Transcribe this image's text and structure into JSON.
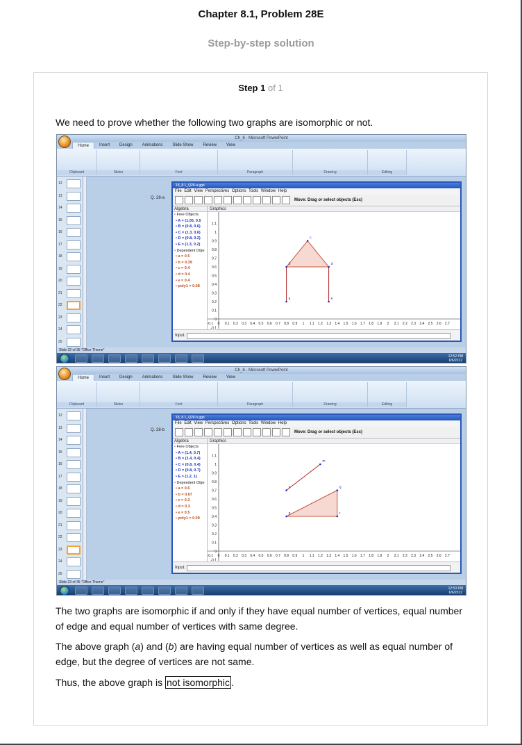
{
  "header": {
    "title": "Chapter 8.1, Problem 28E",
    "subtitle": "Step-by-step solution"
  },
  "step": {
    "label": "Step 1",
    "of_text": "of 1"
  },
  "paragraphs": {
    "intro": "We need to prove whether the following two graphs are isomorphic or not.",
    "p1": "The two graphs are isomorphic if and only if they have equal number of vertices, equal number of edge and equal number of vertices with same degree.",
    "p2_before_a": "The above graph (",
    "p2_a": "a",
    "p2_mid": ") and (",
    "p2_b": "b",
    "p2_after": ") are having equal number of vertices as well as equal number of edge, but the degree of vertices are not same.",
    "p3_before": "Thus, the above graph is ",
    "p3_boxed": "not isomorphic",
    "p3_after": "."
  },
  "screenshots": [
    {
      "window_title": "Ch_8 - Microsoft PowerPoint",
      "ribbon_tabs": [
        "Home",
        "Insert",
        "Design",
        "Animations",
        "Slide Show",
        "Review",
        "View"
      ],
      "slide_label": "Q. 28-a",
      "geogebra_title": "18_8.1_Q28-a.ggb",
      "geogebra_menu": "File Edit View Perspectives Options Tools Window Help",
      "toolbar_hint": "Move: Drag or select objects (Esc)",
      "algebra_header": "Algebra",
      "graphics_header": "Graphics",
      "free_header": "Free Objects",
      "free": [
        "A = (1.05, 0.5",
        "B = (0.8, 0.6)",
        "C = (1.3, 0.6)",
        "D = (0.8, 0.2)",
        "E = (1.3, 0.2)"
      ],
      "dep_header": "Dependent Obje",
      "dependent": [
        "a = 0.5",
        "b = 0.39",
        "c = 0.4",
        "d = 0.4",
        "e = 0.4",
        "poly1 = 0.08"
      ],
      "input_label": "Input:",
      "status": "Slide 22 of 35   \"Office Theme\"",
      "clock_time": "12:52 PM",
      "clock_date": "6/6/2012",
      "thumb_numbers": [
        "12",
        "13",
        "14",
        "15",
        "16",
        "17",
        "18",
        "19",
        "20",
        "21",
        "22",
        "23",
        "24",
        "25"
      ],
      "selected_thumb": 10,
      "points": [
        {
          "label": "c",
          "x": 1.05,
          "y": 0.9
        },
        {
          "label": "b",
          "x": 0.8,
          "y": 0.6
        },
        {
          "label": "d",
          "x": 1.3,
          "y": 0.6
        },
        {
          "label": "a",
          "x": 0.8,
          "y": 0.2
        },
        {
          "label": "e",
          "x": 1.3,
          "y": 0.2
        }
      ],
      "polygon": [
        [
          0.8,
          0.6
        ],
        [
          1.05,
          0.9
        ],
        [
          1.3,
          0.6
        ]
      ],
      "segments": [
        [
          [
            0.8,
            0.6
          ],
          [
            0.8,
            0.2
          ]
        ],
        [
          [
            1.3,
            0.6
          ],
          [
            1.3,
            0.2
          ]
        ]
      ]
    },
    {
      "window_title": "Ch_8 - Microsoft PowerPoint",
      "ribbon_tabs": [
        "Home",
        "Insert",
        "Design",
        "Animations",
        "Slide Show",
        "Review",
        "View"
      ],
      "slide_label": "Q. 28-b",
      "geogebra_title": "18_8.1_Q28-b.ggb",
      "geogebra_menu": "File Edit View Perspectives Options Tools Window Help",
      "toolbar_hint": "Move: Drag or select objects (Esc)",
      "algebra_header": "Algebra",
      "graphics_header": "Graphics",
      "free_header": "Free Objects",
      "free": [
        "A = (1.4, 0.7)",
        "B = (1.4, 0.4)",
        "C = (0.8, 0.4)",
        "D = (0.8, 0.7)",
        "E = (1.2, 1)"
      ],
      "dep_header": "Dependent Obje",
      "dependent": [
        "a = 0.6",
        "b = 0.67",
        "c = 0.3",
        "d = 0.3",
        "e = 0.5",
        "poly1 = 0.09"
      ],
      "input_label": "Input:",
      "status": "Slide 23 of 35   \"Office Theme\"",
      "clock_time": "12:53 PM",
      "clock_date": "6/6/2012",
      "thumb_numbers": [
        "12",
        "13",
        "14",
        "15",
        "16",
        "17",
        "18",
        "19",
        "20",
        "21",
        "22",
        "23",
        "24",
        "25"
      ],
      "selected_thumb": 11,
      "points": [
        {
          "label": "m",
          "x": 1.2,
          "y": 1.0
        },
        {
          "label": "n",
          "x": 0.8,
          "y": 0.7
        },
        {
          "label": "q",
          "x": 1.4,
          "y": 0.7
        },
        {
          "label": "p",
          "x": 0.8,
          "y": 0.4
        },
        {
          "label": "r",
          "x": 1.4,
          "y": 0.4
        }
      ],
      "polygon": [
        [
          0.8,
          0.4
        ],
        [
          1.4,
          0.7
        ],
        [
          1.4,
          0.4
        ]
      ],
      "segments": [
        [
          [
            0.8,
            0.7
          ],
          [
            1.2,
            1.0
          ]
        ]
      ]
    }
  ],
  "axis": {
    "x_ticks": [
      "-0.1",
      "0",
      "0.1",
      "0.2",
      "0.3",
      "0.4",
      "0.5",
      "0.6",
      "0.7",
      "0.8",
      "0.9",
      "1",
      "1.1",
      "1.2",
      "1.3",
      "1.4",
      "1.5",
      "1.6",
      "1.7",
      "1.8",
      "1.9",
      "2",
      "2.1",
      "2.2",
      "2.3",
      "2.4",
      "2.5",
      "2.6",
      "2.7"
    ],
    "y_ticks": [
      "1.1",
      "1",
      "0.9",
      "0.8",
      "0.7",
      "0.6",
      "0.5",
      "0.4",
      "0.3",
      "0.2",
      "0.1",
      "0",
      "-0.1"
    ]
  },
  "colors": {
    "polygon_stroke": "#c8573a",
    "polygon_fill": "#f6d9d2",
    "segment": "#b02020",
    "point": "#1a2fbf",
    "label_blue": "#1a2fbf"
  }
}
